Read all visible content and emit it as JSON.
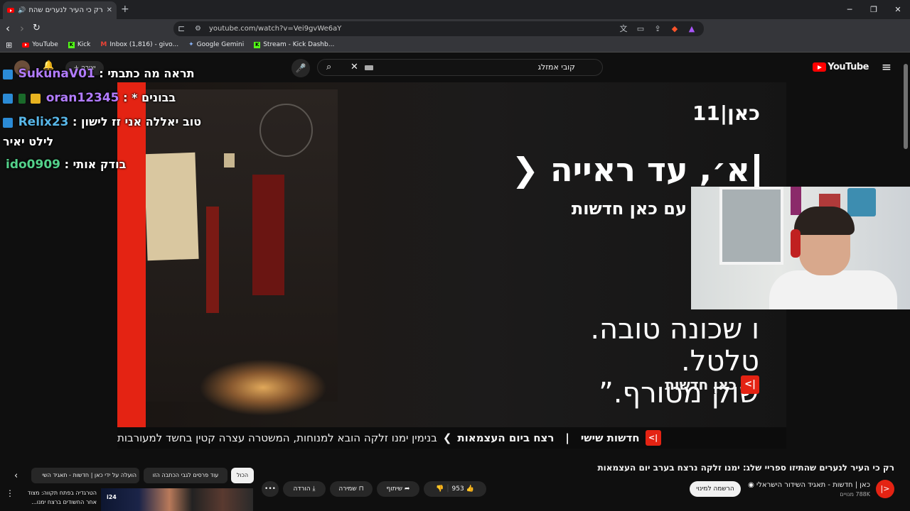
{
  "browser": {
    "tab_title": "רק כי העיר לנערים שהתיזו ספ",
    "new_tab": "+",
    "url": "youtube.com/watch?v=Vei9gvWe6aY",
    "bookmarks": [
      {
        "label": "YouTube",
        "icon": "youtube-icon"
      },
      {
        "label": "Kick",
        "icon": "kick-icon"
      },
      {
        "label": "Inbox (1,816) - givo...",
        "icon": "gmail-icon"
      },
      {
        "label": "Google Gemini",
        "icon": "gemini-icon"
      },
      {
        "label": "Stream - Kick Dashb...",
        "icon": "kick-icon"
      }
    ]
  },
  "youtube": {
    "logo_text": "YouTube",
    "search_query": "קובי אמזלג",
    "create_label": "יצירה"
  },
  "video": {
    "channel_bug": "כאן|11",
    "headline": "א׳, עד ראייה",
    "subline": "עם כאן חדשות",
    "quote_lines": [
      "ו שכונה טובה.",
      "טלטל.",
      "שוק מטורף.”"
    ],
    "logo_text": "כאן חדשות",
    "logo_mark": "|>",
    "ticker_show": "חדשות שישי",
    "ticker_topic": "רצח ביום העצמאות",
    "ticker_text": "בנימין ימנו זלקה הובא למנוחות, המשטרה עצרה קטין בחשד למעורבות"
  },
  "chat": [
    {
      "user": "SukunaV01",
      "message": "תראה מה כתבתי",
      "user_color": "#b27cff",
      "badge_color": "#2b8bd6"
    },
    {
      "user": "oran12345",
      "message": "* בבונים",
      "user_color": "#b27cff",
      "badge_color": "#2b8bd6"
    },
    {
      "user": "Relix23",
      "message": "טוב יאללה אני זז לישון",
      "user_color": "#58b7e8",
      "badge_color": "#2b8bd6"
    },
    {
      "user": "",
      "message": "לילט יאיר",
      "user_color": "#ffffff",
      "badge_color": ""
    },
    {
      "user": "ido0909",
      "message": "בודק אותי",
      "user_color": "#53d18a",
      "badge_color": ""
    }
  ],
  "below": {
    "title": "רק כי העיר לנערים שהתיזו ספריי שלג: ימנו זלקה נרצח בערב יום העצמאות",
    "channel_name": "כאן | חדשות - תאגיד השידור הישראלי",
    "subscribers": "788K מנויים",
    "subscribe_label": "הרשמה למינוי",
    "like_count": "953",
    "share_label": "שיתוף",
    "save_label": "שמירה",
    "download_label": "הורדה",
    "chips": [
      "הכול",
      "עוד פרסים לגבי הכתבה הזו",
      "הועלה על ידי כאן | חדשות - תאגיד השי"
    ],
    "rec_text": "הטרגדיה בפתח תקווה: מצוד אחר החשודים ברצח ימנו..."
  },
  "colors": {
    "kan_red": "#e42313",
    "youtube_red": "#ff0000",
    "page_bg": "#0f0f0f"
  }
}
